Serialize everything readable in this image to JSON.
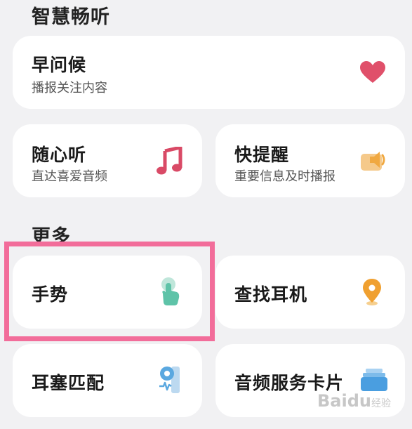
{
  "sections": {
    "smart_listen": {
      "title": "智慧畅听"
    },
    "more": {
      "title": "更多"
    }
  },
  "cards": {
    "morning_greeting": {
      "title": "早问候",
      "subtitle": "播报关注内容",
      "icon": "heart-icon"
    },
    "casual_listen": {
      "title": "随心听",
      "subtitle": "直达喜爱音频",
      "icon": "music-note-icon"
    },
    "quick_reminder": {
      "title": "快提醒",
      "subtitle": "重要信息及时播报",
      "icon": "speaker-icon"
    },
    "gesture": {
      "title": "手势",
      "icon": "touch-gesture-icon"
    },
    "find_earphones": {
      "title": "查找耳机",
      "icon": "location-pin-icon"
    },
    "ear_tip_fit": {
      "title": "耳塞匹配",
      "icon": "earbud-fit-icon"
    },
    "audio_service_cards": {
      "title": "音频服务卡片",
      "icon": "card-stack-icon"
    }
  },
  "colors": {
    "background": "#f1f1f3",
    "highlight": "#f26d9a",
    "heart": "#e0506a",
    "music": "#d94a66",
    "speaker": "#f0a840",
    "gesture": "#5ec3a8",
    "pin": "#f0a030",
    "earbud": "#5aa8e0",
    "stack": "#4a9ee0"
  },
  "watermark": {
    "text": "Baidu",
    "sub": "经验"
  }
}
